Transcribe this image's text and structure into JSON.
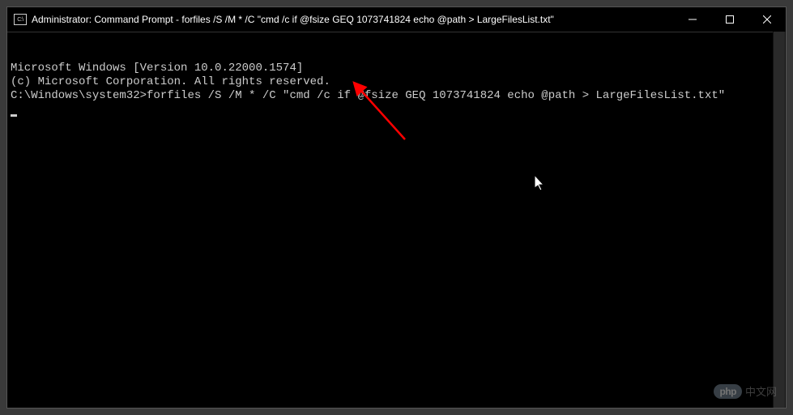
{
  "window": {
    "title": "Administrator: Command Prompt - forfiles  /S /M * /C \"cmd /c if @fsize GEQ 1073741824 echo @path > LargeFilesList.txt\"",
    "icon_glyph": "C:\\"
  },
  "terminal": {
    "line1": "Microsoft Windows [Version 10.0.22000.1574]",
    "line2": "(c) Microsoft Corporation. All rights reserved.",
    "blank": "",
    "prompt": "C:\\Windows\\system32>",
    "command": "forfiles /S /M * /C \"cmd /c if @fsize GEQ 1073741824 echo @path > LargeFilesList.txt\""
  },
  "watermark": {
    "pill": "php",
    "text": "中文网"
  }
}
